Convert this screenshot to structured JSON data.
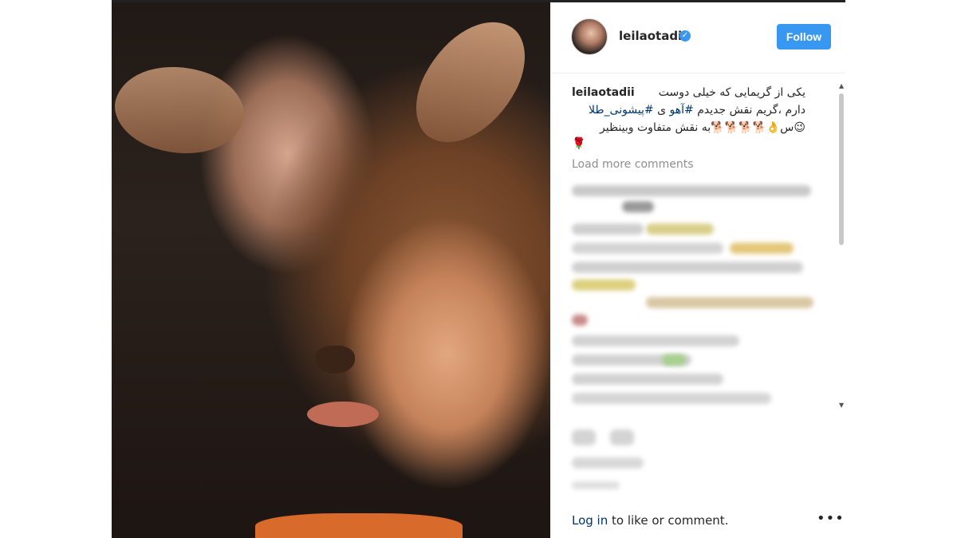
{
  "post": {
    "username": "leilaotadii",
    "follow_label": "Follow",
    "caption_user": "leilaotadii",
    "caption_lines": [
      "یکی از گریمایی که خیلی دوست",
      "دارم ،گریم نقش جدیدم #آهو ی #پیشونی_طلا",
      "😉س👌🐕🐕🐕🐕به نقش متفاوت وبینظیر",
      "🌹"
    ],
    "caption_line2_pre": "دارم ،گریم نقش جدیدم ",
    "caption_tag1": "#آهو",
    "caption_mid": " ی ",
    "caption_tag2": "#پیشونی_طلا",
    "load_more": "Load more comments",
    "verified_glyph": "✓",
    "more_glyph": "•••"
  },
  "footer": {
    "login_link": "Log in",
    "login_rest": " to like or comment."
  },
  "colors": {
    "accent": "#3897f0",
    "link": "#003569",
    "muted": "#8e8e8e"
  },
  "icons": [
    "verified-badge-icon",
    "more-options-icon",
    "scroll-up-icon",
    "scroll-down-icon"
  ]
}
